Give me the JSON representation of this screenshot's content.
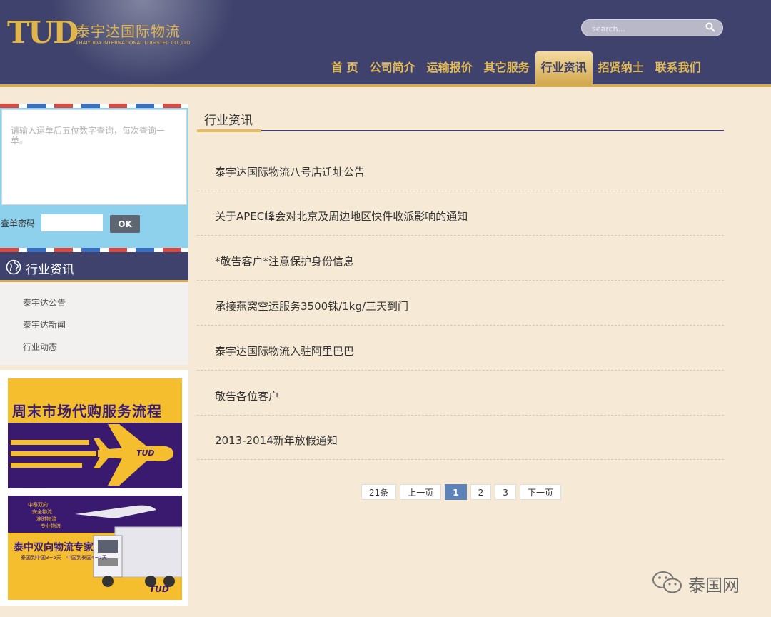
{
  "header": {
    "logo_mark": "TUD",
    "logo_cn": "泰宇达国际物流",
    "logo_en": "THAIYUDA INTERNATIONAL LOGISTEC CO.,LTD",
    "search_placeholder": "search..."
  },
  "nav": {
    "items": [
      {
        "label": "首 页"
      },
      {
        "label": "公司简介"
      },
      {
        "label": "运输报价"
      },
      {
        "label": "其它服务"
      },
      {
        "label": "行业资讯"
      },
      {
        "label": "招贤纳士"
      },
      {
        "label": "联系我们"
      }
    ],
    "active": "行业资讯"
  },
  "query": {
    "placeholder": "请输入运单后五位数字查询，每次查询一单。",
    "password_label": "查单密码",
    "ok_label": "OK"
  },
  "sidebar": {
    "title": "行业资讯",
    "items": [
      {
        "label": "泰宇达公告"
      },
      {
        "label": "泰宇达新闻"
      },
      {
        "label": "行业动态"
      }
    ]
  },
  "ads": {
    "ad1_title": "周末市场代购服务流程",
    "ad1_logo": "TUD",
    "ad2_tags": [
      "中泰双向",
      "安全物流",
      "准时物流",
      "专业物流"
    ],
    "ad2_title": "泰中双向物流专家",
    "ad2_sub1": "泰国到中国3~5天",
    "ad2_sub2": "中国到泰国4~7天",
    "ad2_logo": "TUD"
  },
  "main": {
    "title": "行业资讯",
    "news": [
      {
        "title": "泰宇达国际物流八号店迁址公告"
      },
      {
        "title": "关于APEC峰会对北京及周边地区快件收派影响的通知"
      },
      {
        "title": "*敬告客户*注意保护身份信息"
      },
      {
        "title": "承接燕窝空运服务3500铢/1kg/三天到门"
      },
      {
        "title": "泰宇达国际物流入驻阿里巴巴"
      },
      {
        "title": "敬告各位客户"
      },
      {
        "title": "2013-2014新年放假通知"
      }
    ]
  },
  "pager": {
    "total": "21条",
    "prev": "上一页",
    "pages": [
      "1",
      "2",
      "3"
    ],
    "current": "1",
    "next": "下一页"
  },
  "watermark": {
    "text": "泰国网"
  },
  "colors": {
    "header_bg": "#3e426c",
    "gold": "#e4bb56",
    "page_bg": "#f6ead6",
    "query_bg": "#8ed1ec",
    "pager_active": "#5d82b8"
  }
}
